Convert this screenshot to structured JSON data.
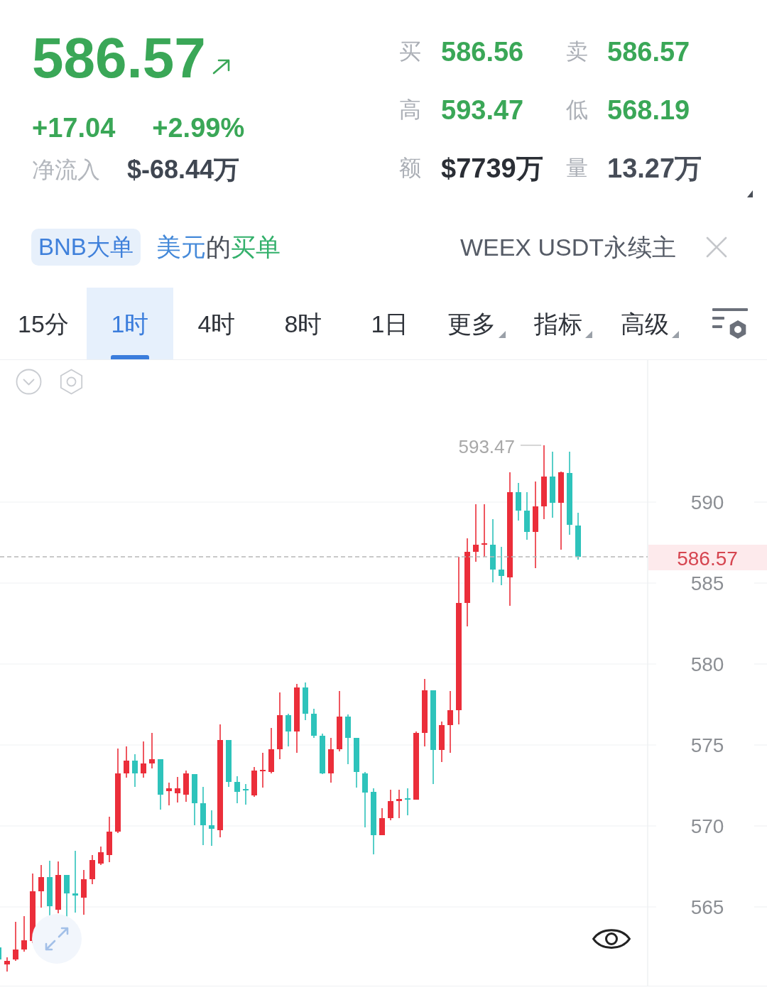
{
  "quote": {
    "price": "586.57",
    "rising": true,
    "change": "+17.04",
    "change_percent": "+2.99%",
    "net_inflow_label": "净流入",
    "net_inflow": "$-68.44万"
  },
  "stats": [
    {
      "label": "买",
      "value": "586.56",
      "color": "#3aa757"
    },
    {
      "label": "卖",
      "value": "586.57",
      "color": "#3aa757"
    },
    {
      "label": "高",
      "value": "593.47",
      "color": "#3aa757"
    },
    {
      "label": "低",
      "value": "568.19",
      "color": "#3aa757"
    },
    {
      "label": "额",
      "value": "$7739万",
      "color": "#2a2e35"
    },
    {
      "label": "量",
      "value": "13.27万",
      "color": "#474d58"
    }
  ],
  "filter_bar": {
    "chip": "BNB大单",
    "ticker": [
      {
        "text": "美元",
        "color": "#4489d9"
      },
      {
        "text": "的",
        "color": "#4a4f59"
      },
      {
        "text": "买单",
        "color": "#33b06b"
      }
    ],
    "pair_text": "WEEX USDT永续主"
  },
  "tabs": [
    {
      "label": "15分",
      "selected": false,
      "dropdown": false
    },
    {
      "label": "1时",
      "selected": true,
      "dropdown": false
    },
    {
      "label": "4时",
      "selected": false,
      "dropdown": false
    },
    {
      "label": "8时",
      "selected": false,
      "dropdown": false
    },
    {
      "label": "1日",
      "selected": false,
      "dropdown": false
    },
    {
      "label": "更多",
      "selected": false,
      "dropdown": true
    },
    {
      "label": "指标",
      "selected": false,
      "dropdown": true
    },
    {
      "label": "高级",
      "selected": false,
      "dropdown": true
    }
  ],
  "chart": {
    "y_axis": [
      "590",
      "585",
      "580",
      "575",
      "570",
      "565"
    ],
    "high_label": "593.47",
    "last_price": "586.57"
  }
}
